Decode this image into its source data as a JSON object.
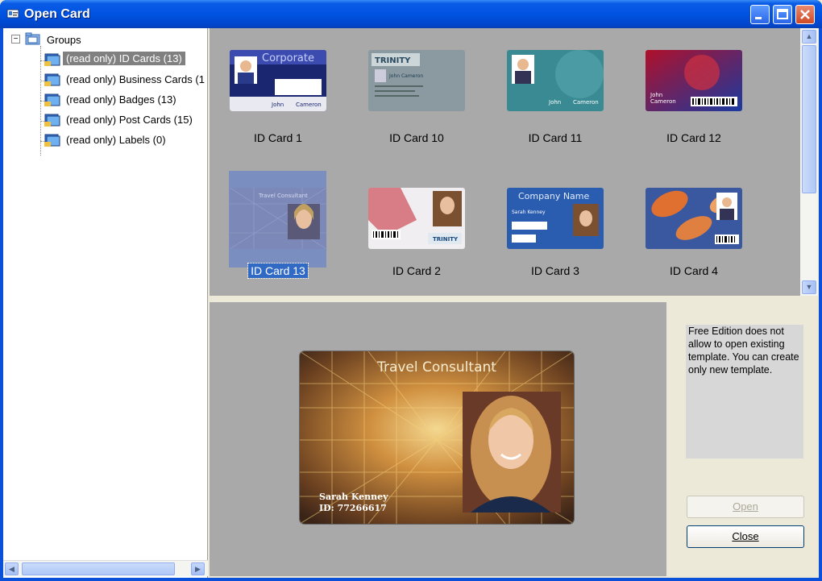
{
  "window": {
    "title": "Open Card"
  },
  "tree": {
    "root_label": "Groups",
    "items": [
      {
        "label": "(read only) ID Cards (13)",
        "selected": true
      },
      {
        "label": "(read only) Business Cards (1",
        "selected": false
      },
      {
        "label": "(read only) Badges (13)",
        "selected": false
      },
      {
        "label": "(read only) Post Cards (15)",
        "selected": false
      },
      {
        "label": "(read only) Labels (0)",
        "selected": false
      }
    ]
  },
  "gallery": {
    "cards": [
      {
        "label": "ID Card 1",
        "texts": [
          "Corporate",
          "John",
          "Cameron"
        ]
      },
      {
        "label": "ID Card 10",
        "texts": [
          "TRINITY",
          "John Cameron"
        ]
      },
      {
        "label": "ID Card 11",
        "texts": [
          "John",
          "Cameron"
        ]
      },
      {
        "label": "ID Card 12",
        "texts": [
          "John",
          "Cameron"
        ]
      },
      {
        "label": "ID Card 13",
        "texts": [
          "Travel Consultant"
        ]
      },
      {
        "label": "ID Card 2",
        "texts": [
          "TRINITY"
        ]
      },
      {
        "label": "ID Card 3",
        "texts": [
          "Company Name",
          "Sarah Kenney"
        ]
      },
      {
        "label": "ID Card 4",
        "texts": []
      }
    ],
    "selected_index": 4
  },
  "preview": {
    "card_title": "Travel Consultant",
    "person_name": "Sarah Kenney",
    "person_id": "ID: 77266617"
  },
  "side_panel": {
    "notice": "Free Edition does not allow to open existing template. You can create only new template.",
    "open_label": "Open",
    "close_label": "Close"
  },
  "colors": {
    "titlebar": "#0053e1",
    "selection": "#316ac5",
    "gallery_bg": "#a9a9a9"
  }
}
